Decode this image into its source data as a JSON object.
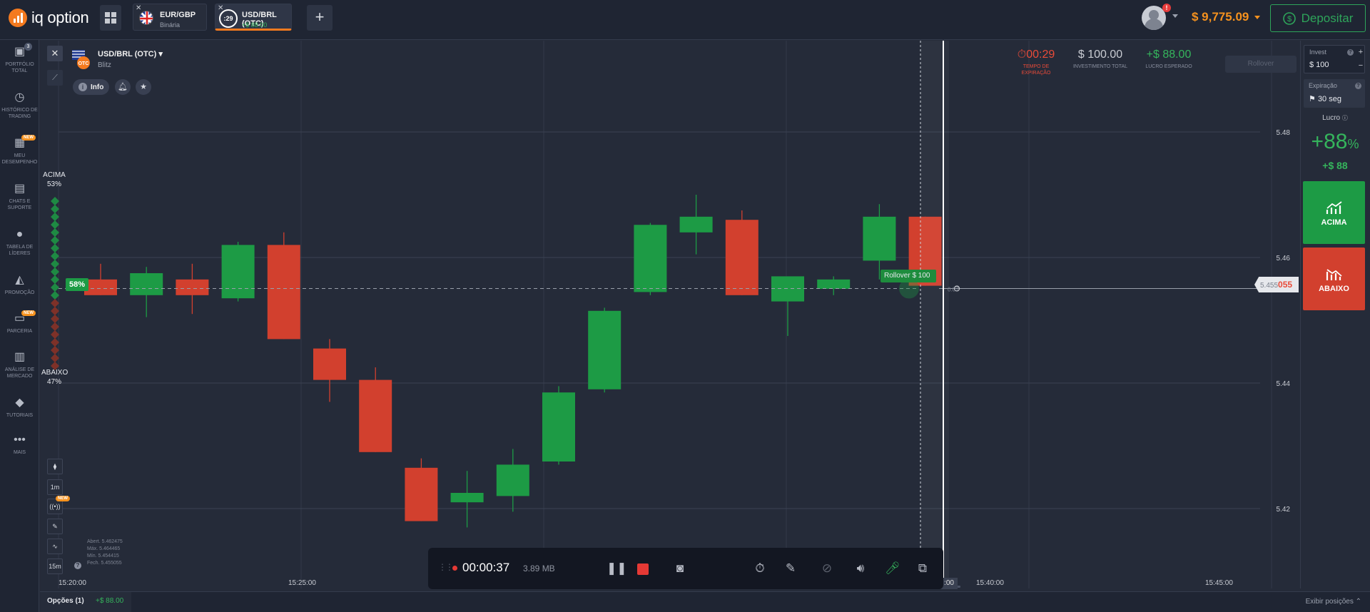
{
  "header": {
    "logo_text": "iq option",
    "tabs": [
      {
        "name": "EUR/GBP",
        "sub": "Binária"
      },
      {
        "name": "USD/BRL (OTC)",
        "sub": "+$ 88.00",
        "timer": ":29"
      }
    ],
    "notification_count": "!",
    "balance": "$ 9,775.09",
    "deposit_label": "Depositar"
  },
  "sidebar": {
    "items": [
      {
        "label": "PORTFÓLIO TOTAL",
        "badge": "3",
        "icon": "briefcase-icon"
      },
      {
        "label": "HISTÓRICO DE TRADING",
        "icon": "clock-icon"
      },
      {
        "label": "MEU DESEMPENHO",
        "badge": "NEW",
        "icon": "dashboard-icon"
      },
      {
        "label": "CHATS E SUPORTE",
        "icon": "chat-icon"
      },
      {
        "label": "TABELA DE LÍDERES",
        "icon": "leaderboard-icon"
      },
      {
        "label": "PROMOÇÃO",
        "icon": "promo-icon"
      },
      {
        "label": "PARCERIA",
        "badge": "NEW",
        "icon": "partner-icon"
      },
      {
        "label": "ANÁLISE DE MERCADO",
        "icon": "analysis-icon"
      },
      {
        "label": "TUTORIAIS",
        "icon": "graduation-cap-icon"
      },
      {
        "label": "MAIS",
        "icon": "more-icon"
      }
    ]
  },
  "asset": {
    "title": "USD/BRL (OTC)",
    "subtitle": "Blitz",
    "info_label": "Info"
  },
  "sentiment": {
    "up_label": "ACIMA",
    "up_pct": "53%",
    "down_label": "ABAIXO",
    "down_pct": "47%",
    "current_pct": "58%"
  },
  "trade_stats": {
    "time_left": "00:29",
    "time_left_label": "TEMPO DE EXPIRAÇÃO",
    "investment": "$ 100.00",
    "investment_label": "INVESTIMENTO TOTAL",
    "expected_profit": "+$ 88.00",
    "expected_profit_label": "LUCRO ESPERADO",
    "rollover_label": "Rollover"
  },
  "rollover_tip": "Rollover  $ 100",
  "price_marker": {
    "prefix": "5.455",
    "suffix": "055"
  },
  "ohlc": {
    "open": "Abert.  5.462475",
    "high": "Máx.   5.464465",
    "low": "Mín.    5.454415",
    "close": "Fech.  5.455055"
  },
  "tools": {
    "interval_1": "1m",
    "interval_2": "15m",
    "tool_badge": "NEW"
  },
  "time_axis": [
    "15:20:00",
    "15:25:00",
    "15:40:00",
    "15:45:00"
  ],
  "time_axis_current": ":00",
  "price_axis": [
    "5.48",
    "5.46",
    "5.44",
    "5.42"
  ],
  "marker_small": "0.07",
  "recorder": {
    "time": "00:00:37",
    "size": "3.89 MB"
  },
  "right_panel": {
    "invest_label": "Invest",
    "invest_prefix": "$",
    "invest_value": "100",
    "expiration_label": "Expiração",
    "expiration_value": "30 seg",
    "profit_label": "Lucro",
    "profit_pct": "+88",
    "profit_pct_sign": "%",
    "profit_amount": "+$ 88",
    "up_label": "ACIMA",
    "down_label": "ABAIXO"
  },
  "bottom": {
    "options_label": "Opções (1)",
    "options_profit": "+$ 88.00",
    "show_positions": "Exibir posições"
  },
  "colors": {
    "up": "#1d9b45",
    "down": "#d2402e",
    "accent": "#f6921e"
  },
  "chart_data": {
    "type": "candlestick",
    "ylim": [
      5.415,
      5.49
    ],
    "candles": [
      {
        "o": 5.4565,
        "h": 5.459,
        "l": 5.454,
        "c": 5.454
      },
      {
        "o": 5.454,
        "h": 5.4585,
        "l": 5.4505,
        "c": 5.4575
      },
      {
        "o": 5.4565,
        "h": 5.459,
        "l": 5.451,
        "c": 5.454
      },
      {
        "o": 5.4535,
        "h": 5.4625,
        "l": 5.453,
        "c": 5.462
      },
      {
        "o": 5.462,
        "h": 5.464,
        "l": 5.447,
        "c": 5.447
      },
      {
        "o": 5.4455,
        "h": 5.447,
        "l": 5.437,
        "c": 5.4405
      },
      {
        "o": 5.4405,
        "h": 5.4425,
        "l": 5.429,
        "c": 5.429
      },
      {
        "o": 5.4265,
        "h": 5.428,
        "l": 5.418,
        "c": 5.418
      },
      {
        "o": 5.421,
        "h": 5.426,
        "l": 5.417,
        "c": 5.4225
      },
      {
        "o": 5.422,
        "h": 5.4295,
        "l": 5.4195,
        "c": 5.427
      },
      {
        "o": 5.4275,
        "h": 5.4395,
        "l": 5.427,
        "c": 5.4385
      },
      {
        "o": 5.439,
        "h": 5.452,
        "l": 5.4385,
        "c": 5.4515
      },
      {
        "o": 5.4545,
        "h": 5.4655,
        "l": 5.454,
        "c": 5.4652
      },
      {
        "o": 5.464,
        "h": 5.47,
        "l": 5.4605,
        "c": 5.4665
      },
      {
        "o": 5.466,
        "h": 5.4675,
        "l": 5.454,
        "c": 5.454
      },
      {
        "o": 5.453,
        "h": 5.455,
        "l": 5.4475,
        "c": 5.457
      },
      {
        "o": 5.455,
        "h": 5.457,
        "l": 5.454,
        "c": 5.4565
      },
      {
        "o": 5.4595,
        "h": 5.4685,
        "l": 5.4565,
        "c": 5.4665
      },
      {
        "o": 5.4665,
        "h": 5.4665,
        "l": 5.4555,
        "c": 5.4555
      }
    ],
    "current_price": 5.455055
  }
}
